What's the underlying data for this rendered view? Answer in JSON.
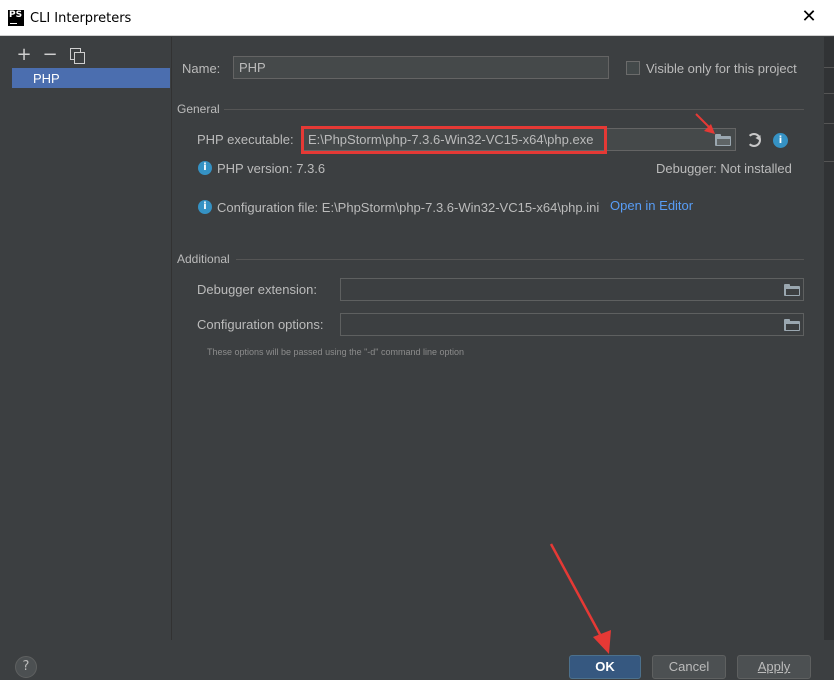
{
  "window": {
    "title": "CLI Interpreters",
    "app_icon_text": "PS"
  },
  "left": {
    "items": [
      {
        "label": "PHP",
        "selected": true
      }
    ]
  },
  "form": {
    "name_label": "Name:",
    "name_value": "PHP",
    "visible_only_label": "Visible only for this project",
    "visible_only_checked": false,
    "general_title": "General",
    "php_exec_label": "PHP executable:",
    "php_exec_value": "E:\\PhpStorm\\php-7.3.6-Win32-VC15-x64\\php.exe",
    "php_version_text": "PHP version: 7.3.6",
    "debugger_text": "Debugger: Not installed",
    "config_file_text": "Configuration file: E:\\PhpStorm\\php-7.3.6-Win32-VC15-x64\\php.ini",
    "open_in_editor": "Open in Editor",
    "additional_title": "Additional",
    "debugger_ext_label": "Debugger extension:",
    "debugger_ext_value": "",
    "config_options_label": "Configuration options:",
    "config_options_value": "",
    "hint_text": "These options will be passed using the \"-d\" command line option"
  },
  "buttons": {
    "help": "?",
    "ok": "OK",
    "cancel": "Cancel",
    "apply": "Apply"
  },
  "colors": {
    "background": "#3c3f41",
    "selection": "#4b6eaf",
    "link": "#589df6",
    "annotation": "#e53935",
    "primary_button": "#365880"
  }
}
